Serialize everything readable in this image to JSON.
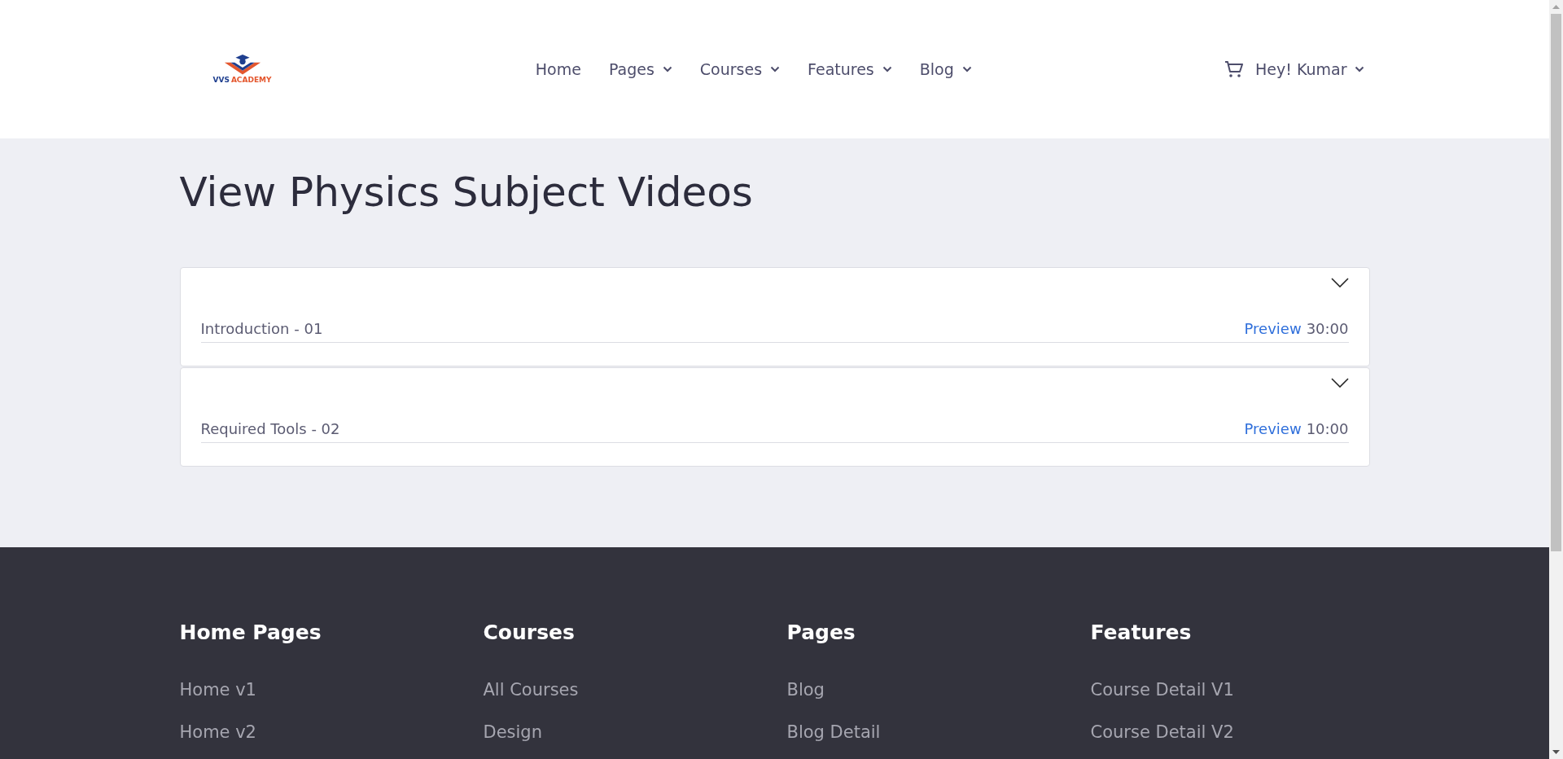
{
  "logo": {
    "part_1": "VVS",
    "part_2": "ACADEMY"
  },
  "nav": [
    {
      "label": "Home",
      "dropdown": false
    },
    {
      "label": "Pages",
      "dropdown": true
    },
    {
      "label": "Courses",
      "dropdown": true
    },
    {
      "label": "Features",
      "dropdown": true
    },
    {
      "label": "Blog",
      "dropdown": true
    }
  ],
  "user_menu": {
    "label": "Hey! Kumar"
  },
  "page_title": "View Physics Subject Videos",
  "lessons": [
    {
      "title": "Introduction - 01",
      "preview": "Preview",
      "duration": "30:00",
      "expanded": false
    },
    {
      "title": "Required Tools - 02",
      "preview": "Preview",
      "duration": "10:00",
      "expanded": false
    }
  ],
  "footer": {
    "columns": [
      {
        "heading": "Home Pages",
        "links": [
          "Home v1",
          "Home v2"
        ]
      },
      {
        "heading": "Courses",
        "links": [
          "All Courses",
          "Design"
        ]
      },
      {
        "heading": "Pages",
        "links": [
          "Blog",
          "Blog Detail"
        ]
      },
      {
        "heading": "Features",
        "links": [
          "Course Detail V1",
          "Course Detail V2"
        ]
      }
    ]
  }
}
